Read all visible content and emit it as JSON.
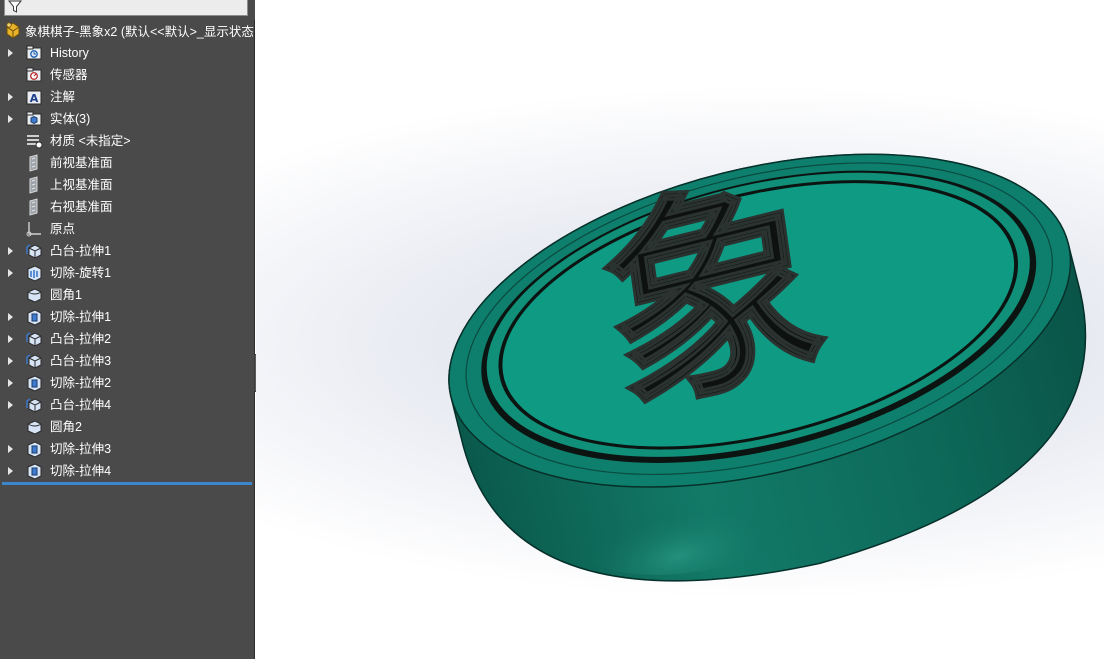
{
  "feature_tree": {
    "root_label": "象棋棋子-黑象x2 (默认<<默认>_显示状态",
    "items": [
      {
        "label": "History",
        "icon": "history-folder-icon",
        "expandable": true
      },
      {
        "label": "传感器",
        "icon": "sensors-folder-icon",
        "expandable": false
      },
      {
        "label": "注解",
        "icon": "annotations-icon",
        "expandable": true
      },
      {
        "label": "实体(3)",
        "icon": "solid-bodies-folder-icon",
        "expandable": true
      },
      {
        "label": "材质 <未指定>",
        "icon": "material-icon",
        "expandable": false
      },
      {
        "label": "前视基准面",
        "icon": "plane-icon",
        "expandable": false
      },
      {
        "label": "上视基准面",
        "icon": "plane-icon",
        "expandable": false
      },
      {
        "label": "右视基准面",
        "icon": "plane-icon",
        "expandable": false
      },
      {
        "label": "原点",
        "icon": "origin-icon",
        "expandable": false
      },
      {
        "label": "凸台-拉伸1",
        "icon": "boss-extrude-icon",
        "expandable": true
      },
      {
        "label": "切除-旋转1",
        "icon": "cut-revolve-icon",
        "expandable": true
      },
      {
        "label": "圆角1",
        "icon": "fillet-icon",
        "expandable": false
      },
      {
        "label": "切除-拉伸1",
        "icon": "cut-extrude-icon",
        "expandable": true
      },
      {
        "label": "凸台-拉伸2",
        "icon": "boss-extrude-icon",
        "expandable": true
      },
      {
        "label": "凸台-拉伸3",
        "icon": "boss-extrude-icon",
        "expandable": true
      },
      {
        "label": "切除-拉伸2",
        "icon": "cut-extrude-icon",
        "expandable": true
      },
      {
        "label": "凸台-拉伸4",
        "icon": "boss-extrude-icon",
        "expandable": true
      },
      {
        "label": "圆角2",
        "icon": "fillet-icon",
        "expandable": false
      },
      {
        "label": "切除-拉伸3",
        "icon": "cut-extrude-icon",
        "expandable": true
      },
      {
        "label": "切除-拉伸4",
        "icon": "cut-extrude-icon",
        "expandable": true
      }
    ]
  },
  "model": {
    "character": "象",
    "colors": {
      "piece_side": "#0e6b5c",
      "piece_top": "#0f9a83",
      "groove": "#0b0f0e",
      "character": "#0d1110",
      "panel_bg": "#4a4a4a",
      "rollback": "#3b86cc"
    }
  }
}
